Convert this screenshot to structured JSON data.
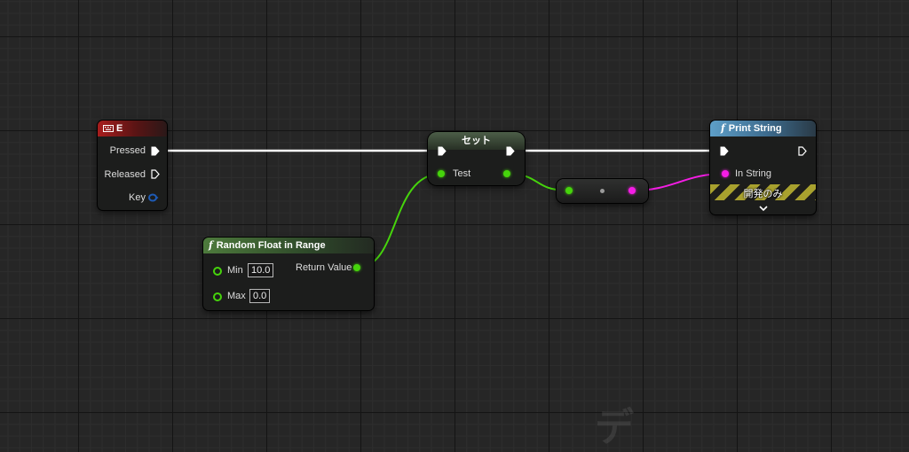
{
  "key_event": {
    "title": "E",
    "icon": "keyboard-icon",
    "pins": {
      "pressed": "Pressed",
      "released": "Released",
      "key": "Key"
    }
  },
  "set_node": {
    "title": "セット",
    "variable": "Test"
  },
  "random_node": {
    "title": "Random Float in Range",
    "icon": "function-icon",
    "min_label": "Min",
    "min_value": "10.0",
    "max_label": "Max",
    "max_value": "0.0",
    "return_label": "Return Value"
  },
  "print_node": {
    "title": "Print String",
    "icon": "function-icon",
    "in_string": "In String",
    "dev_only": "開発のみ"
  },
  "watermark": "デ",
  "colors": {
    "exec": "#ffffff",
    "float": "#46d40c",
    "string": "#f51de5",
    "key_struct": "#1e5bb5",
    "key_header": "#a81d1d",
    "func_pure": "#4d7a3c",
    "func_impure": "#5e9fc8",
    "dev_stripe": "#a8a12e"
  }
}
